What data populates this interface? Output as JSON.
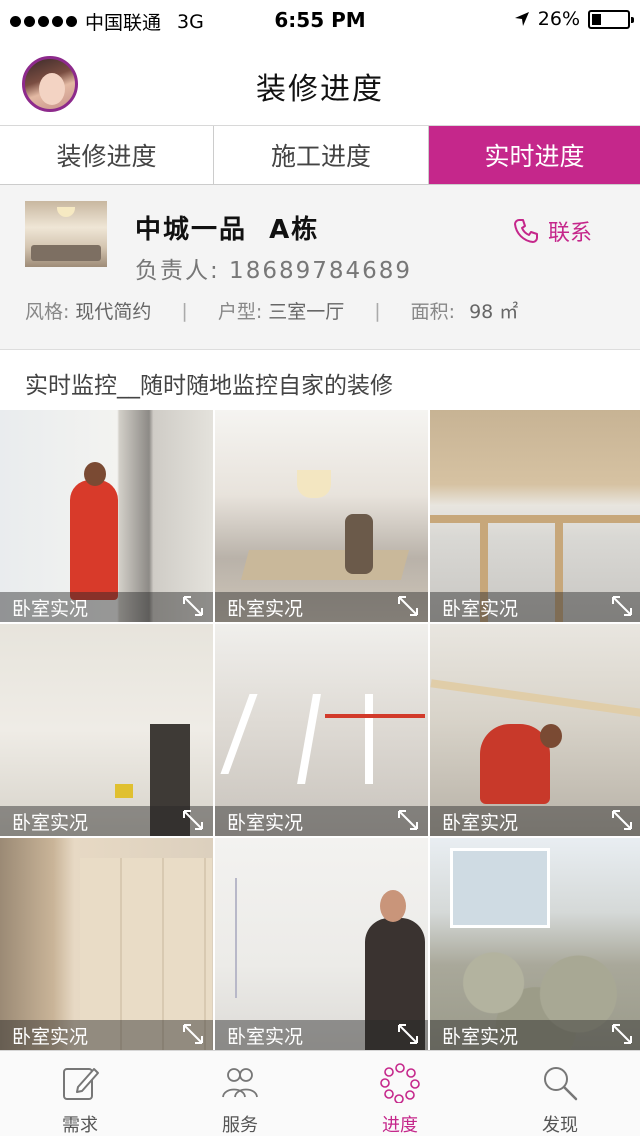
{
  "status_bar": {
    "carrier": "中国联通",
    "network": "3G",
    "time": "6:55 PM",
    "battery_percent": "26%",
    "battery_level": 0.26
  },
  "header": {
    "title": "装修进度"
  },
  "tabs": [
    {
      "label": "装修进度",
      "active": false
    },
    {
      "label": "施工进度",
      "active": false
    },
    {
      "label": "实时进度",
      "active": true
    }
  ],
  "project": {
    "name": "中城一品  A栋",
    "manager": "负责人: 18689784689",
    "contact_label": "联系",
    "style_label": "风格:",
    "style_value": "现代简约",
    "layout_label": "户型:",
    "layout_value": "三室一厅",
    "area_label": "面积:",
    "area_value": "98 ㎡"
  },
  "monitor": {
    "title": "实时监控__随时随地监控自家的装修",
    "items": [
      {
        "caption": "卧室实况"
      },
      {
        "caption": "卧室实况"
      },
      {
        "caption": "卧室实况"
      },
      {
        "caption": "卧室实况"
      },
      {
        "caption": "卧室实况"
      },
      {
        "caption": "卧室实况"
      },
      {
        "caption": "卧室实况"
      },
      {
        "caption": "卧室实况"
      },
      {
        "caption": "卧室实况"
      }
    ]
  },
  "bottom_nav": [
    {
      "label": "需求",
      "icon": "edit-icon",
      "active": false
    },
    {
      "label": "服务",
      "icon": "users-icon",
      "active": false
    },
    {
      "label": "进度",
      "icon": "progress-icon",
      "active": true
    },
    {
      "label": "发现",
      "icon": "search-icon",
      "active": false
    }
  ],
  "colors": {
    "accent": "#c5278b"
  }
}
